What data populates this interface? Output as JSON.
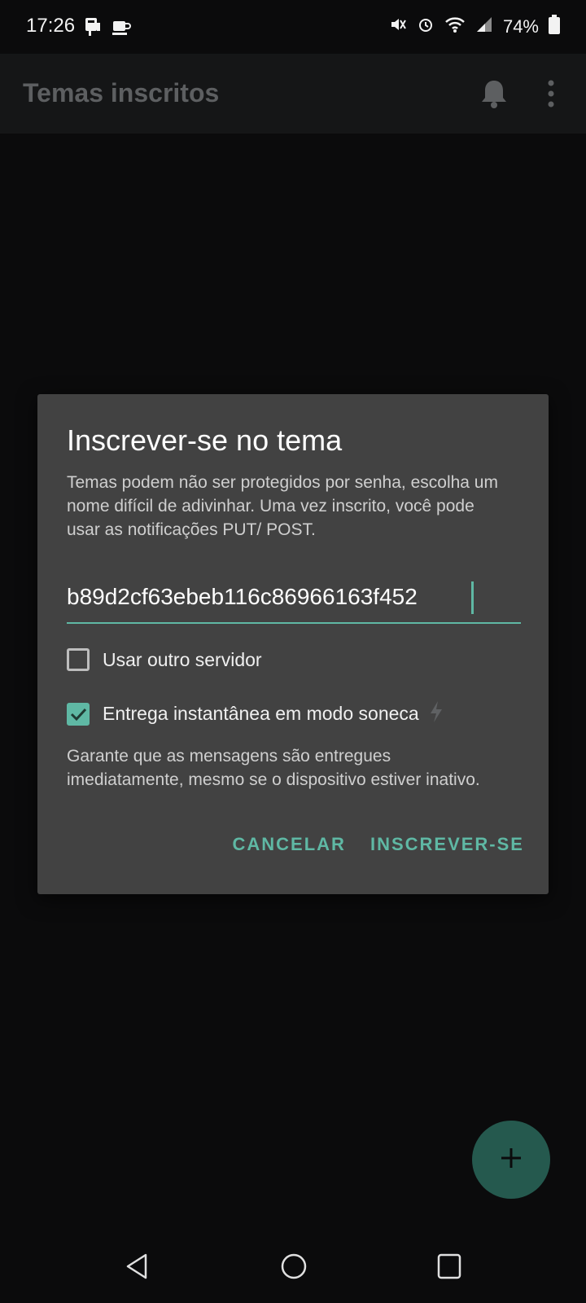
{
  "status_bar": {
    "time": "17:26",
    "battery": "74%",
    "icons": [
      "device-icon",
      "coffee-icon",
      "mute-icon",
      "alarm-icon",
      "wifi-icon",
      "signal-icon",
      "battery-icon"
    ]
  },
  "app_bar": {
    "title": "Temas inscritos",
    "icons": [
      "bell-icon",
      "more-vert-icon"
    ]
  },
  "dialog": {
    "title": "Inscrever-se no tema",
    "description": "Temas podem não ser protegidos por senha, escolha um nome difícil de adivinhar. Uma vez inscrito, você pode usar as notificações PUT/ POST.",
    "topic_value": "b89d2cf63ebeb116c86966163f452",
    "use_other_server_label": "Usar outro servidor",
    "use_other_server_checked": false,
    "instant_delivery_label": "Entrega instantânea em modo soneca",
    "instant_delivery_checked": true,
    "helper_text": "Garante que as mensagens são entregues imediatamente, mesmo se o dispositivo estiver inativo.",
    "cancel_label": "CANCELAR",
    "subscribe_label": "INSCREVER-SE"
  },
  "fab": {
    "icon": "plus-icon"
  },
  "nav_bar": {
    "icons": [
      "back-icon",
      "home-icon",
      "recents-icon"
    ]
  },
  "colors": {
    "accent": "#5fb8a4",
    "dialog_bg": "#424242",
    "background": "#0b0b0c",
    "fab_bg": "#25594e"
  }
}
